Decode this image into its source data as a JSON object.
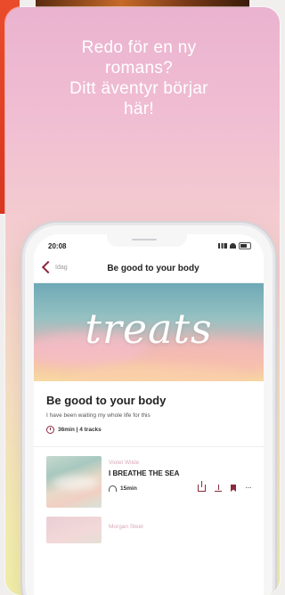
{
  "headline": [
    "Redo för en ny",
    "romans?",
    "Ditt äventyr börjar",
    "här!"
  ],
  "phone": {
    "status_time": "20:08",
    "nav": {
      "back_label": "Idag",
      "title": "Be good to your body"
    },
    "hero_word": "treats",
    "playlist": {
      "title": "Be good to your body",
      "subtitle": "I have been waiting my whole life for this",
      "meta": "36min | 4 tracks"
    },
    "tracks": [
      {
        "artist": "Violet Wilde",
        "title": "I BREATHE THE SEA",
        "duration": "15min"
      },
      {
        "artist": "Morgan Steel"
      }
    ]
  },
  "colors": {
    "accent": "#8a2a3c",
    "artist": "#d8a8b8"
  }
}
